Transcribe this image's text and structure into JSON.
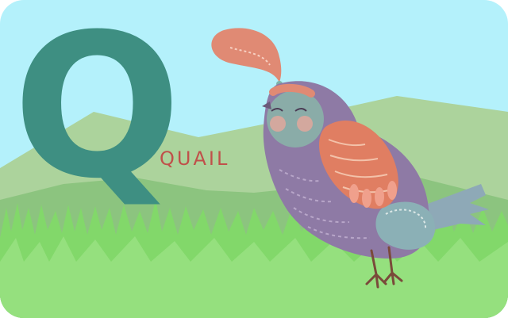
{
  "card": {
    "letter": "Q",
    "word": "QUAIL"
  },
  "colors": {
    "sky": "#b4f1fb",
    "far_hills": "#acd39c",
    "near_hills": "#88c27b",
    "grass": "#82d86a",
    "letter": "#3e8f82",
    "word": "#c0504a",
    "bird_body": "#8e7aa5",
    "bird_face": "#84aaa8",
    "bird_wing": "#e07e62",
    "crest": "#e08a74"
  },
  "illustration": {
    "subject": "quail-bird",
    "icons": [
      "quail-icon",
      "grass-icon",
      "hills-icon"
    ]
  }
}
